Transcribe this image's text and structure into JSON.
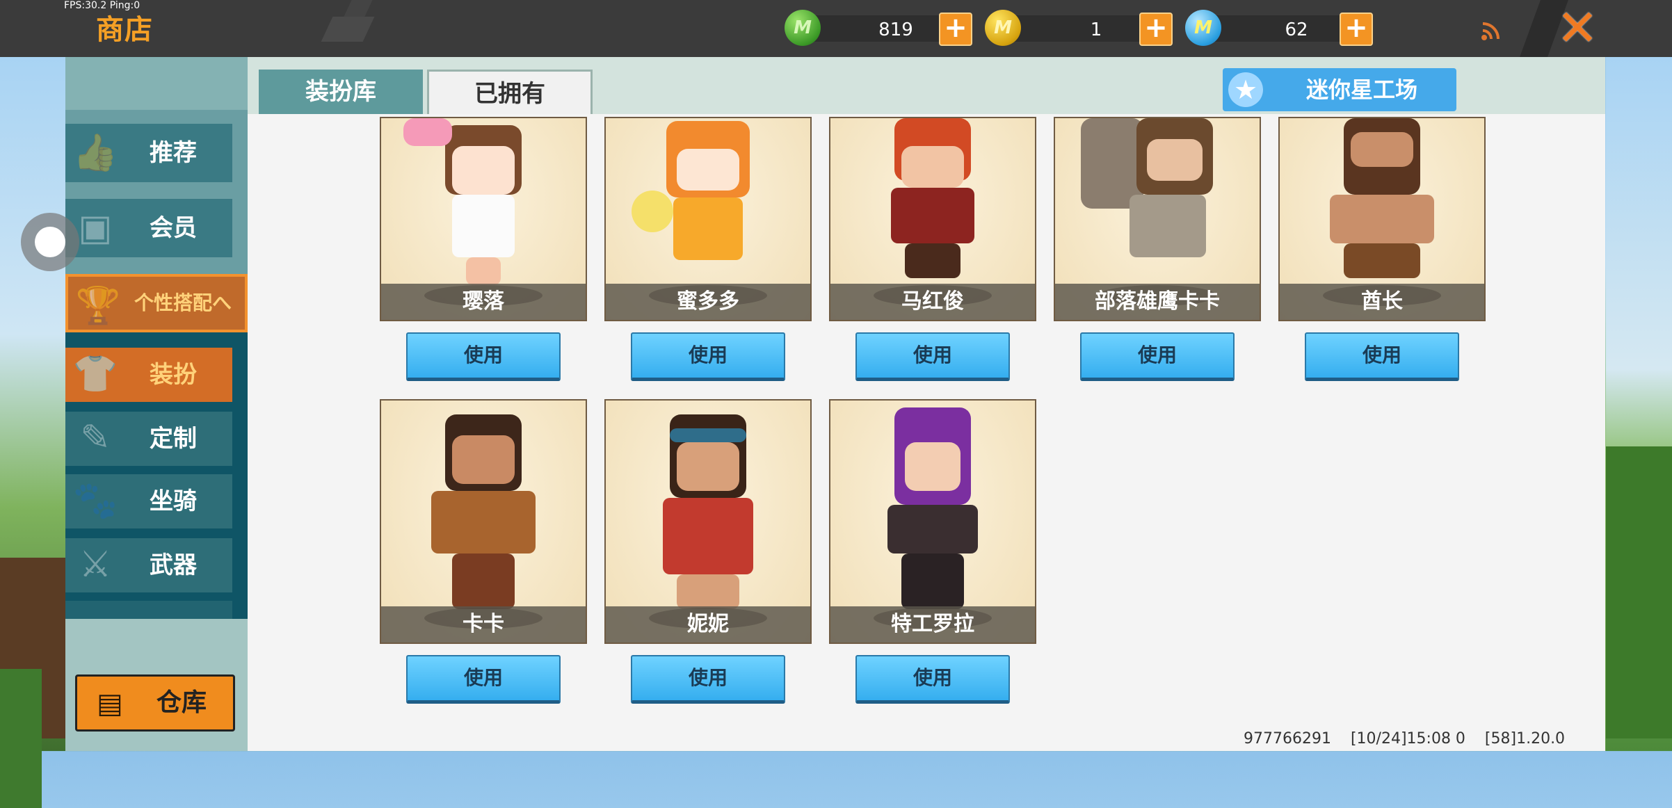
{
  "top_bar": {
    "fps": "FPS:30.2  Ping:0",
    "title": "商店",
    "currencies": [
      {
        "name": "gem",
        "value": "819",
        "icon": "gem-icon"
      },
      {
        "name": "coin",
        "value": "1",
        "icon": "coin-icon"
      },
      {
        "name": "mini-bean",
        "value": "62",
        "icon": "mini-coin-icon"
      }
    ],
    "plus_symbol": "+",
    "close_symbol": "✕"
  },
  "sidebar": {
    "items": [
      {
        "label": "推荐",
        "icon": "thumbs-up-icon"
      },
      {
        "label": "会员",
        "icon": "vip-card-icon"
      },
      {
        "label": "个性搭配へ",
        "icon": "trophy-icon"
      }
    ],
    "sub_items": [
      {
        "label": "装扮",
        "icon": "shirt-icon"
      },
      {
        "label": "定制",
        "icon": "pencil-icon"
      },
      {
        "label": "坐骑",
        "icon": "mount-icon"
      },
      {
        "label": "武器",
        "icon": "gun-icon"
      }
    ],
    "storage_label": "仓库"
  },
  "tabs": [
    {
      "label": "装扮库",
      "active": false
    },
    {
      "label": "已拥有",
      "active": true
    }
  ],
  "workshop_label": "迷你星工场",
  "use_label": "使用",
  "skins": [
    {
      "name": "璎落"
    },
    {
      "name": "蜜多多"
    },
    {
      "name": "马红俊"
    },
    {
      "name": "部落雄鹰卡卡"
    },
    {
      "name": "酋长"
    },
    {
      "name": "卡卡"
    },
    {
      "name": "妮妮"
    },
    {
      "name": "特工罗拉"
    }
  ],
  "footer": {
    "uid": "977766291",
    "datetime": "[10/24]15:08 0",
    "version": "[58]1.20.0"
  },
  "colors": {
    "accent_orange": "#f39423",
    "use_button_blue": "#35aeef",
    "topbar": "#3b3b3b"
  }
}
